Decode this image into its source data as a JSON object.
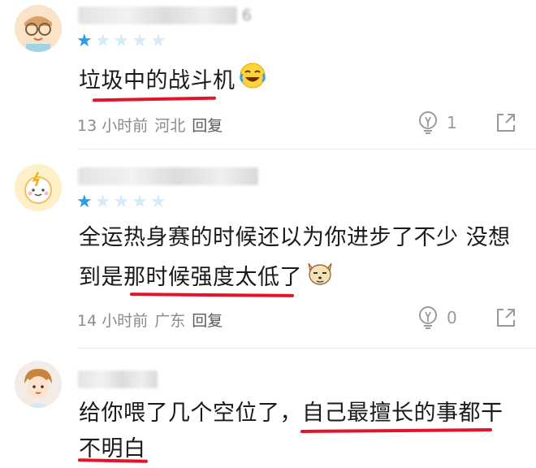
{
  "comments": [
    {
      "text": "垃圾中的战斗机",
      "rating": 1,
      "time": "13 小时前",
      "location": "河北",
      "reply": "回复",
      "likes": "1",
      "username_tail": "6"
    },
    {
      "text_line1": "全运热身赛的时候还以为你进步了不少 没想",
      "text_line2": "到是那时候强度太低了",
      "rating": 1,
      "time": "14 小时前",
      "location": "广东",
      "reply": "回复",
      "likes": "0"
    },
    {
      "text_line1": "给你喂了几个空位了，自己最擅长的事都干",
      "text_line2": "不明白"
    }
  ],
  "colors": {
    "star_on": "#2e9be6",
    "star_off": "#d4ecf8",
    "underline": "#e0142b"
  }
}
